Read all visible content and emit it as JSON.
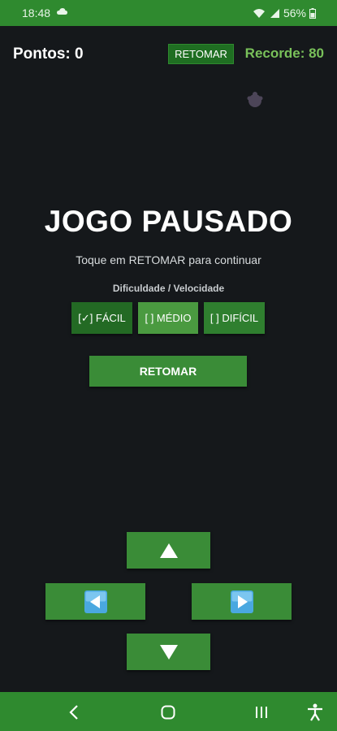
{
  "status_bar": {
    "time": "18:48",
    "battery": "56%"
  },
  "header": {
    "score": "Pontos: 0",
    "resume_small": "RETOMAR",
    "record": "Recorde: 80"
  },
  "pause": {
    "title": "JOGO PAUSADO",
    "subtitle": "Toque em RETOMAR para continuar"
  },
  "difficulty": {
    "label": "Dificuldade / Velocidade",
    "options": [
      {
        "label": "[✓] FÁCIL",
        "selected": true
      },
      {
        "label": "[ ] MÉDIO",
        "selected": false
      },
      {
        "label": "[ ] DIFÍCIL",
        "selected": false
      }
    ]
  },
  "main_resume": "RETOMAR",
  "dpad": {
    "up": "up-arrow-icon",
    "left": "left-arrow-icon",
    "right": "right-arrow-icon",
    "down": "down-arrow-icon"
  },
  "colors": {
    "background": "#15181b",
    "accent_green": "#2f8a2f",
    "button_green": "#3a8c37",
    "record_green": "#79c15a",
    "arrow_blue": "#4aa8e0"
  }
}
